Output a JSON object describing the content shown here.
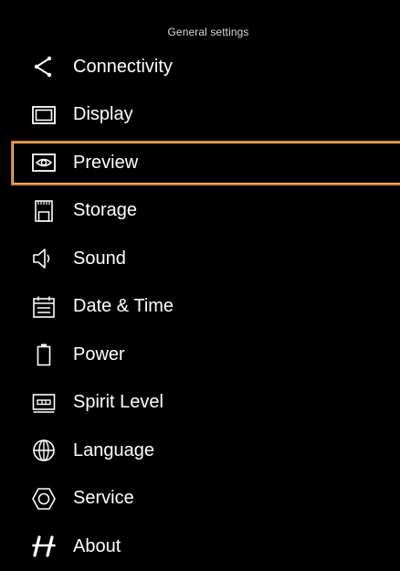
{
  "header": {
    "title": "General settings"
  },
  "menu": {
    "items": [
      {
        "label": "Connectivity",
        "icon": "share-icon",
        "selected": false
      },
      {
        "label": "Display",
        "icon": "display-icon",
        "selected": false
      },
      {
        "label": "Preview",
        "icon": "eye-icon",
        "selected": true
      },
      {
        "label": "Storage",
        "icon": "sd-card-icon",
        "selected": false
      },
      {
        "label": "Sound",
        "icon": "speaker-icon",
        "selected": false
      },
      {
        "label": "Date & Time",
        "icon": "calendar-icon",
        "selected": false
      },
      {
        "label": "Power",
        "icon": "battery-icon",
        "selected": false
      },
      {
        "label": "Spirit Level",
        "icon": "spirit-level-icon",
        "selected": false
      },
      {
        "label": "Language",
        "icon": "globe-icon",
        "selected": false
      },
      {
        "label": "Service",
        "icon": "hexagon-icon",
        "selected": false
      },
      {
        "label": "About",
        "icon": "hasselblad-h-icon",
        "selected": false
      }
    ]
  },
  "colors": {
    "background": "#000000",
    "text": "#ffffff",
    "header_text": "#d8d8d8",
    "selection_border": "#d9822b"
  }
}
